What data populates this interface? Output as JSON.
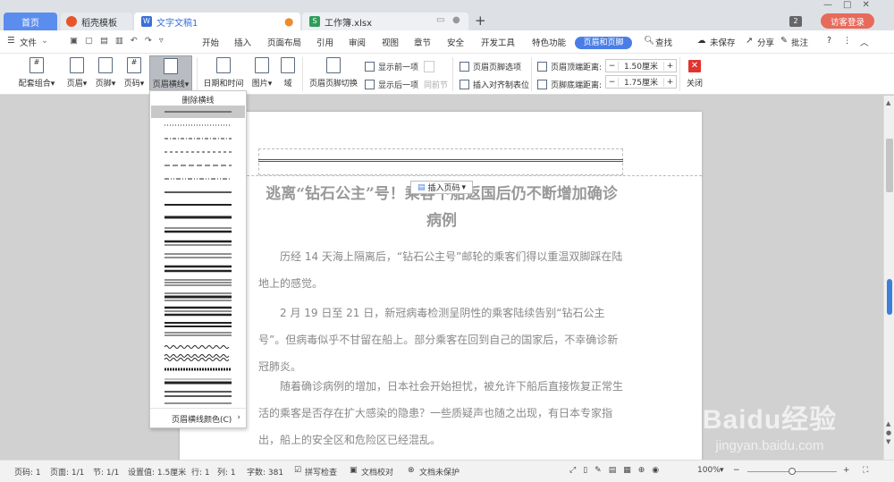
{
  "tabs": [
    {
      "label": "首页"
    },
    {
      "label": "稻壳模板"
    },
    {
      "label": "文字文稿1"
    },
    {
      "label": "工作簿.xlsx"
    }
  ],
  "titlebar": {
    "notif_count": "2",
    "login": "访客登录"
  },
  "menu": {
    "file": "文件",
    "items": [
      "开始",
      "插入",
      "页面布局",
      "引用",
      "审阅",
      "视图",
      "章节",
      "安全",
      "开发工具",
      "特色功能"
    ],
    "active": "页眉和页脚",
    "search": "查找",
    "unsaved": "未保存",
    "share": "分享",
    "comment": "批注"
  },
  "ribbon": {
    "group1": [
      {
        "label": "配套组合"
      },
      {
        "label": "页眉"
      },
      {
        "label": "页脚"
      },
      {
        "label": "页码"
      },
      {
        "label": "页眉横线"
      }
    ],
    "group2": [
      {
        "label": "日期和时间"
      },
      {
        "label": "图片"
      },
      {
        "label": "域"
      }
    ],
    "switch": "页眉页脚切换",
    "show_prev": "显示前一项",
    "show_next": "显示后一项",
    "same_as_prev": "同前节",
    "hf_options": "页眉页脚选项",
    "insert_align_tab": "插入对齐制表位",
    "header_top_label": "页眉顶端距离:",
    "header_top_value": "1.50厘米",
    "footer_bottom_label": "页脚底端距离:",
    "footer_bottom_value": "1.75厘米",
    "close": "关闭"
  },
  "dropdown": {
    "title": "删除横线",
    "footer": "页眉横线颜色(C)",
    "line_styles": [
      "solid-thin",
      "dotted",
      "dash-dot",
      "dashed",
      "long-dash",
      "dash-dot-dot",
      "solid",
      "solid-medium",
      "solid-thick",
      "thin-thick",
      "thick-thin",
      "double",
      "double-thick",
      "triple",
      "thin-thick-thin",
      "thick-thin-thick",
      "triple-thick",
      "thin-double",
      "wave",
      "double-wave",
      "diagonal-hatch",
      "gradient-thick",
      "double-spaced",
      "thin-spaced"
    ]
  },
  "document": {
    "title": "逃离“钻石公主”号！乘客下船返国后仍不断增加确诊病例",
    "insert_page_num": "插入页码",
    "paragraphs": [
      "历经 14 天海上隔离后，“钻石公主号”邮轮的乘客们得以重温双脚踩在陆地上的感觉。",
      "2 月 19 日至 21 日，新冠病毒检测呈阴性的乘客陆续告别“钻石公主号”。但病毒似乎不甘留在船上。部分乘客在回到自己的国家后，不幸确诊新冠肺炎。",
      "随着确诊病例的增加，日本社会开始担忧，被允许下船后直接恢复正常生活的乘客是否存在扩大感染的隐患？一些质疑声也随之出现，有日本专家指出，船上的安全区和危险区已经混乱。"
    ]
  },
  "statusbar": {
    "page": "页码: 1",
    "pages": "页面: 1/1",
    "section": "节: 1/1",
    "setting": "设置值: 1.5厘米",
    "row": "行: 1",
    "col": "列: 1",
    "words": "字数: 381",
    "spell": "拼写检查",
    "proof": "文档校对",
    "protect": "文档未保护",
    "zoom": "100%"
  },
  "watermark": {
    "brand": "Baidu经验",
    "url": "jingyan.baidu.com"
  },
  "colors": {
    "accent": "#4a7ee6",
    "login": "#e76a5b",
    "close": "#e0342f"
  }
}
